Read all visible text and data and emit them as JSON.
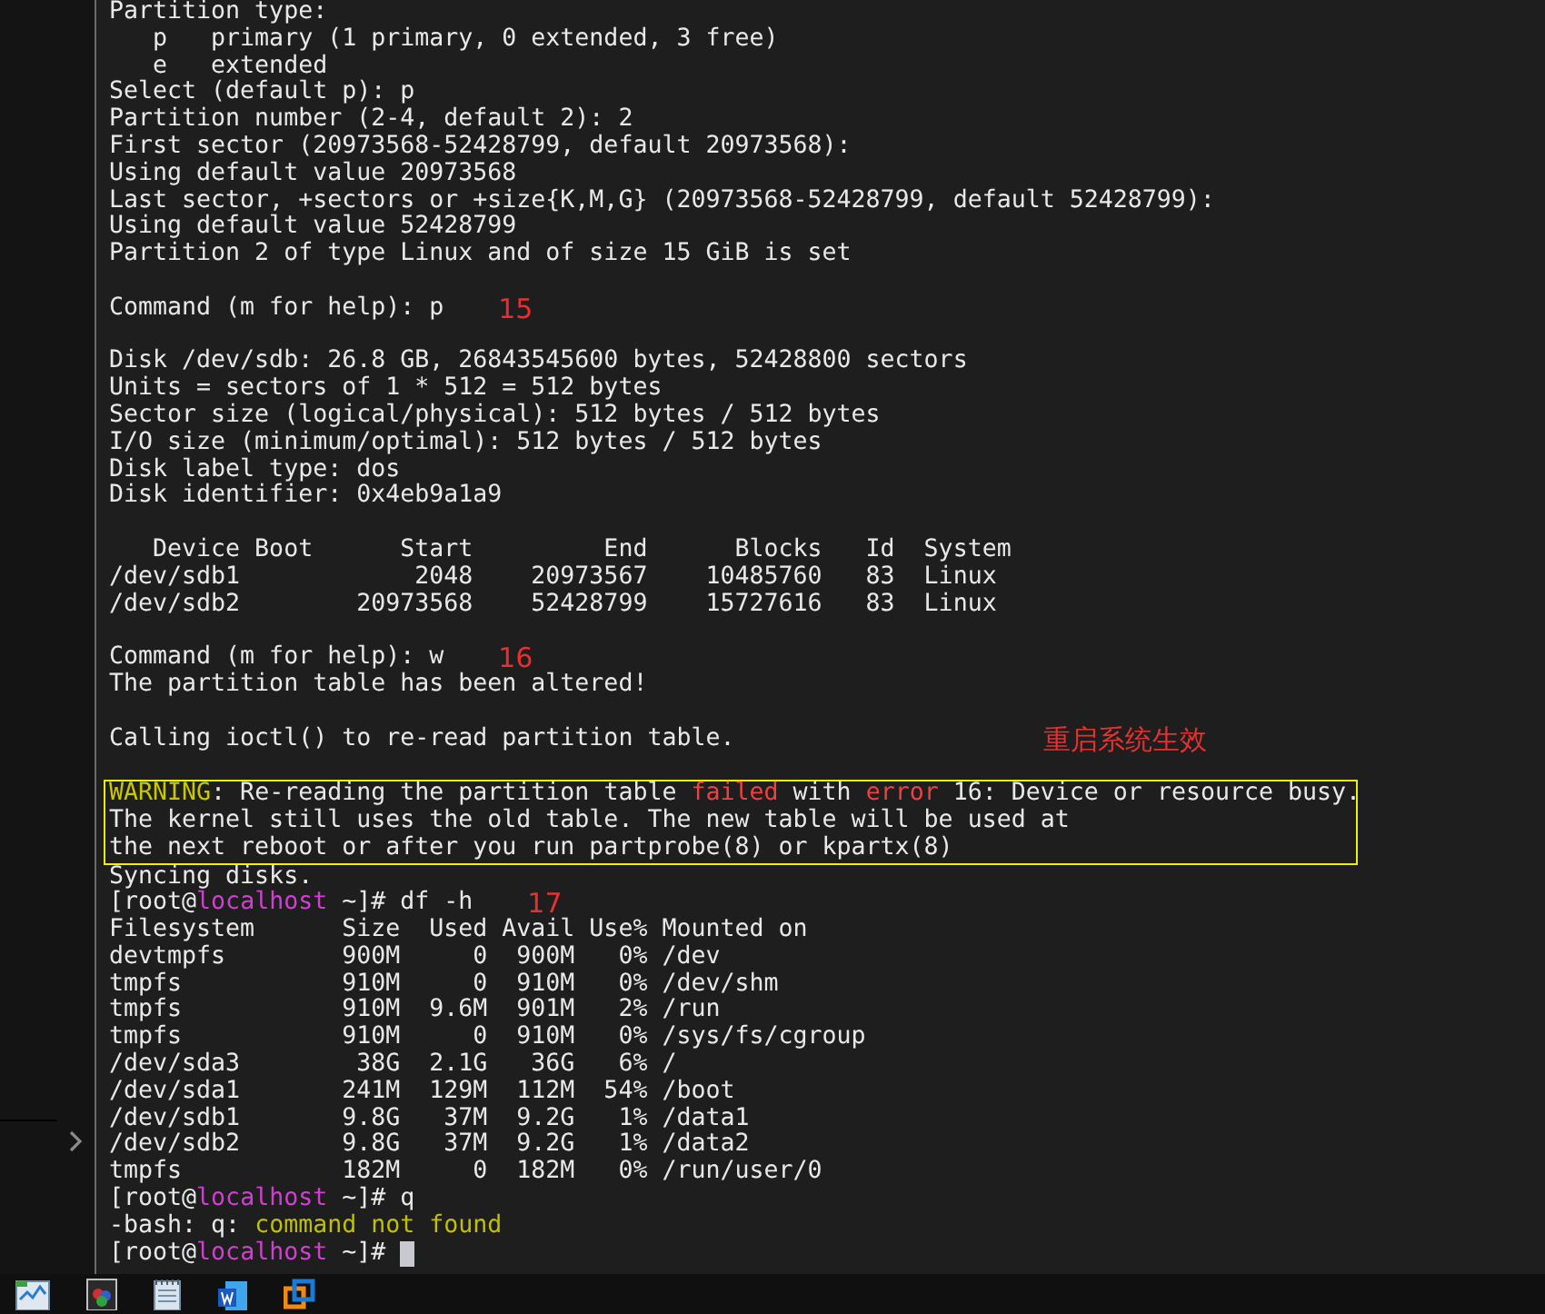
{
  "terminal": {
    "lines": [
      {
        "kind": "text",
        "segments": [
          {
            "kind": "plain",
            "text": "Partition type:"
          }
        ]
      },
      {
        "kind": "text",
        "segments": [
          {
            "kind": "plain",
            "text": "   p   primary (1 primary, 0 extended, 3 free)"
          }
        ]
      },
      {
        "kind": "text",
        "segments": [
          {
            "kind": "plain",
            "text": "   e   extended"
          }
        ]
      },
      {
        "kind": "text",
        "segments": [
          {
            "kind": "plain",
            "text": "Select (default p): p"
          }
        ]
      },
      {
        "kind": "text",
        "segments": [
          {
            "kind": "plain",
            "text": "Partition number (2-4, default 2): 2"
          }
        ]
      },
      {
        "kind": "text",
        "segments": [
          {
            "kind": "plain",
            "text": "First sector (20973568-52428799, default 20973568):"
          }
        ]
      },
      {
        "kind": "text",
        "segments": [
          {
            "kind": "plain",
            "text": "Using default value 20973568"
          }
        ]
      },
      {
        "kind": "text",
        "segments": [
          {
            "kind": "plain",
            "text": "Last sector, +sectors or +size{K,M,G} (20973568-52428799, default 52428799):"
          }
        ]
      },
      {
        "kind": "text",
        "segments": [
          {
            "kind": "plain",
            "text": "Using default value 52428799"
          }
        ]
      },
      {
        "kind": "text",
        "segments": [
          {
            "kind": "plain",
            "text": "Partition 2 of type Linux and of size 15 GiB is set"
          }
        ]
      },
      {
        "kind": "blank"
      },
      {
        "kind": "text",
        "segments": [
          {
            "kind": "plain",
            "text": "Command (m for help): p"
          }
        ],
        "note": "15"
      },
      {
        "kind": "blank"
      },
      {
        "kind": "text",
        "segments": [
          {
            "kind": "plain",
            "text": "Disk /dev/sdb: 26.8 GB, 26843545600 bytes, 52428800 sectors"
          }
        ]
      },
      {
        "kind": "text",
        "segments": [
          {
            "kind": "plain",
            "text": "Units = sectors of 1 * 512 = 512 bytes"
          }
        ]
      },
      {
        "kind": "text",
        "segments": [
          {
            "kind": "plain",
            "text": "Sector size (logical/physical): 512 bytes / 512 bytes"
          }
        ]
      },
      {
        "kind": "text",
        "segments": [
          {
            "kind": "plain",
            "text": "I/O size (minimum/optimal): 512 bytes / 512 bytes"
          }
        ]
      },
      {
        "kind": "text",
        "segments": [
          {
            "kind": "plain",
            "text": "Disk label type: dos"
          }
        ]
      },
      {
        "kind": "text",
        "segments": [
          {
            "kind": "plain",
            "text": "Disk identifier: 0x4eb9a1a9"
          }
        ]
      },
      {
        "kind": "blank"
      },
      {
        "kind": "text",
        "segments": [
          {
            "kind": "plain",
            "text": "   Device Boot      Start         End      Blocks   Id  System"
          }
        ]
      },
      {
        "kind": "text",
        "segments": [
          {
            "kind": "plain",
            "text": "/dev/sdb1            2048    20973567    10485760   83  Linux"
          }
        ]
      },
      {
        "kind": "text",
        "segments": [
          {
            "kind": "plain",
            "text": "/dev/sdb2        20973568    52428799    15727616   83  Linux"
          }
        ]
      },
      {
        "kind": "blank"
      },
      {
        "kind": "text",
        "segments": [
          {
            "kind": "plain",
            "text": "Command (m for help): w"
          }
        ],
        "note": "16"
      },
      {
        "kind": "text",
        "segments": [
          {
            "kind": "plain",
            "text": "The partition table has been altered!"
          }
        ]
      },
      {
        "kind": "blank"
      },
      {
        "kind": "text",
        "segments": [
          {
            "kind": "plain",
            "text": "Calling ioctl() to re-read partition table."
          }
        ],
        "note": "重启系统生效"
      },
      {
        "kind": "blank"
      },
      {
        "kind": "boxed",
        "lines": [
          {
            "kind": "text",
            "segments": [
              {
                "kind": "warning",
                "text": "WARNING"
              },
              {
                "kind": "plain",
                "text": ": Re-reading the partition table "
              },
              {
                "kind": "error",
                "text": "failed"
              },
              {
                "kind": "plain",
                "text": " with "
              },
              {
                "kind": "error",
                "text": "error"
              },
              {
                "kind": "plain",
                "text": " 16: Device or resource busy."
              }
            ]
          },
          {
            "kind": "text",
            "segments": [
              {
                "kind": "plain",
                "text": "The kernel still uses the old table. The new table will be used at"
              }
            ]
          },
          {
            "kind": "text",
            "segments": [
              {
                "kind": "plain",
                "text": "the next reboot or after you run partprobe(8) or kpartx(8)"
              }
            ]
          }
        ]
      },
      {
        "kind": "text",
        "segments": [
          {
            "kind": "plain",
            "text": "Syncing disks."
          }
        ]
      },
      {
        "kind": "text",
        "segments": [
          {
            "kind": "plain",
            "text": "[root@"
          },
          {
            "kind": "host",
            "text": "localhost"
          },
          {
            "kind": "plain",
            "text": " ~]# df -h"
          }
        ],
        "note": "17"
      },
      {
        "kind": "text",
        "segments": [
          {
            "kind": "plain",
            "text": "Filesystem      Size  Used Avail Use% Mounted on"
          }
        ]
      },
      {
        "kind": "text",
        "segments": [
          {
            "kind": "plain",
            "text": "devtmpfs        900M     0  900M   0% /dev"
          }
        ]
      },
      {
        "kind": "text",
        "segments": [
          {
            "kind": "plain",
            "text": "tmpfs           910M     0  910M   0% /dev/shm"
          }
        ]
      },
      {
        "kind": "text",
        "segments": [
          {
            "kind": "plain",
            "text": "tmpfs           910M  9.6M  901M   2% /run"
          }
        ]
      },
      {
        "kind": "text",
        "segments": [
          {
            "kind": "plain",
            "text": "tmpfs           910M     0  910M   0% /sys/fs/cgroup"
          }
        ]
      },
      {
        "kind": "text",
        "segments": [
          {
            "kind": "plain",
            "text": "/dev/sda3        38G  2.1G   36G   6% /"
          }
        ]
      },
      {
        "kind": "text",
        "segments": [
          {
            "kind": "plain",
            "text": "/dev/sda1       241M  129M  112M  54% /boot"
          }
        ]
      },
      {
        "kind": "text",
        "segments": [
          {
            "kind": "plain",
            "text": "/dev/sdb1       9.8G   37M  9.2G   1% /data1"
          }
        ]
      },
      {
        "kind": "text",
        "segments": [
          {
            "kind": "plain",
            "text": "/dev/sdb2       9.8G   37M  9.2G   1% /data2"
          }
        ]
      },
      {
        "kind": "text",
        "segments": [
          {
            "kind": "plain",
            "text": "tmpfs           182M     0  182M   0% /run/user/0"
          }
        ]
      },
      {
        "kind": "text",
        "segments": [
          {
            "kind": "plain",
            "text": "[root@"
          },
          {
            "kind": "host",
            "text": "localhost"
          },
          {
            "kind": "plain",
            "text": " ~]# q"
          }
        ]
      },
      {
        "kind": "text",
        "segments": [
          {
            "kind": "plain",
            "text": "-bash: q: "
          },
          {
            "kind": "notfound",
            "text": "command not found"
          }
        ]
      },
      {
        "kind": "text",
        "segments": [
          {
            "kind": "plain",
            "text": "[root@"
          },
          {
            "kind": "host",
            "text": "localhost"
          },
          {
            "kind": "plain",
            "text": " ~]# "
          }
        ],
        "cursor": true
      }
    ]
  }
}
